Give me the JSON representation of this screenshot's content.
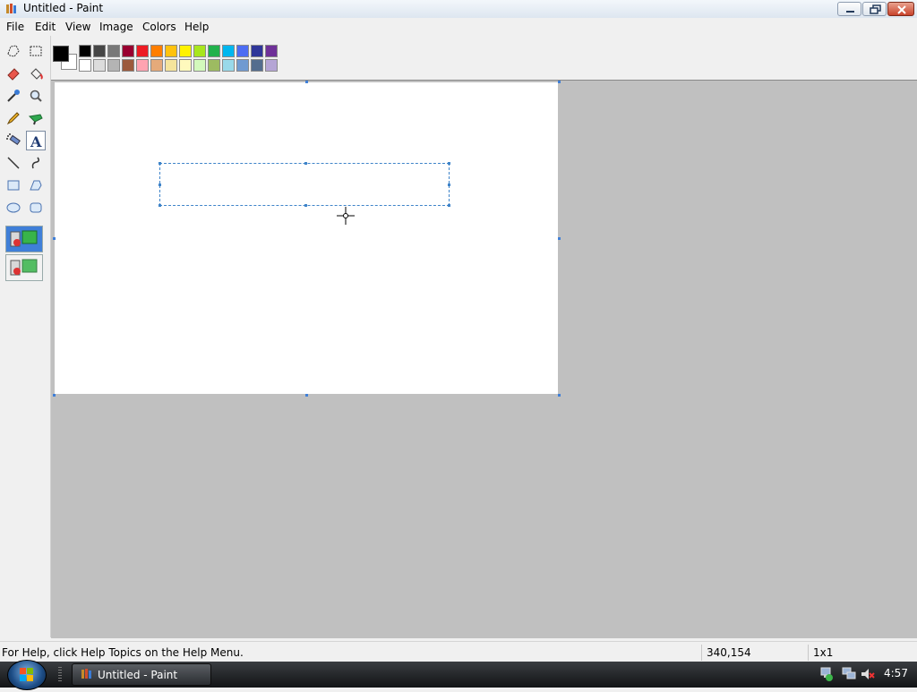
{
  "window": {
    "title": "Untitled - Paint"
  },
  "menu": [
    {
      "id": "file",
      "label": "File"
    },
    {
      "id": "edit",
      "label": "Edit"
    },
    {
      "id": "view",
      "label": "View"
    },
    {
      "id": "image",
      "label": "Image"
    },
    {
      "id": "colors",
      "label": "Colors"
    },
    {
      "id": "help",
      "label": "Help"
    }
  ],
  "tools": [
    {
      "name": "free-form-select-icon"
    },
    {
      "name": "select-icon"
    },
    {
      "name": "eraser-icon"
    },
    {
      "name": "fill-with-color-icon"
    },
    {
      "name": "pick-color-icon"
    },
    {
      "name": "magnifier-icon"
    },
    {
      "name": "pencil-icon"
    },
    {
      "name": "brush-icon"
    },
    {
      "name": "airbrush-icon"
    },
    {
      "name": "text-icon",
      "active": true
    },
    {
      "name": "line-icon"
    },
    {
      "name": "curve-icon"
    },
    {
      "name": "rectangle-icon"
    },
    {
      "name": "polygon-icon"
    },
    {
      "name": "ellipse-icon"
    },
    {
      "name": "rounded-rectangle-icon"
    }
  ],
  "colors": {
    "foreground": "#000000",
    "background": "#ffffff",
    "palette_top": [
      "#000000",
      "#464646",
      "#787878",
      "#990030",
      "#ed1c24",
      "#ff7e00",
      "#ffc20e",
      "#fff200",
      "#a8e61d",
      "#22b14c",
      "#00b7ef",
      "#4d6df3",
      "#2f3699",
      "#6f3198"
    ],
    "palette_bottom": [
      "#ffffff",
      "#dcdcdc",
      "#b4b4b4",
      "#9c5a3c",
      "#ffa3b1",
      "#e5aa7a",
      "#f5e49c",
      "#fff9bd",
      "#d3f9bc",
      "#9dbb61",
      "#99d9ea",
      "#709ad1",
      "#546d8e",
      "#b5a5d5"
    ]
  },
  "status": {
    "help_text": "For Help, click Help Topics on the Help Menu.",
    "coords": "340,154",
    "size": "1x1"
  },
  "taskbar": {
    "active_window": "Untitled - Paint",
    "clock": "4:57"
  }
}
